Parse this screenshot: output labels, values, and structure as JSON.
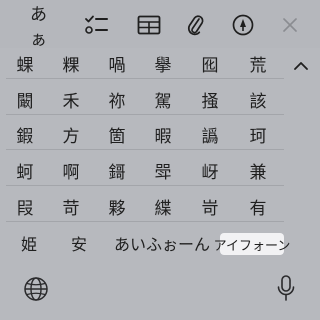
{
  "toolbar": {
    "aa_label": "あぁ"
  },
  "candidates": {
    "rows": [
      [
        "蜾",
        "粿",
        "喎",
        "擧",
        "囮",
        "荒"
      ],
      [
        "闞",
        "禾",
        "祢",
        "駕",
        "掻",
        "該"
      ],
      [
        "鍜",
        "方",
        "箇",
        "暇",
        "譌",
        "珂"
      ],
      [
        "蚵",
        "啊",
        "鎶",
        "斝",
        "岈",
        "兼"
      ],
      [
        "叚",
        "苛",
        "夥",
        "緤",
        "岢",
        "有"
      ]
    ],
    "last_row": [
      "姫",
      "安",
      "あいふぉーん",
      "アイフォーン"
    ]
  }
}
